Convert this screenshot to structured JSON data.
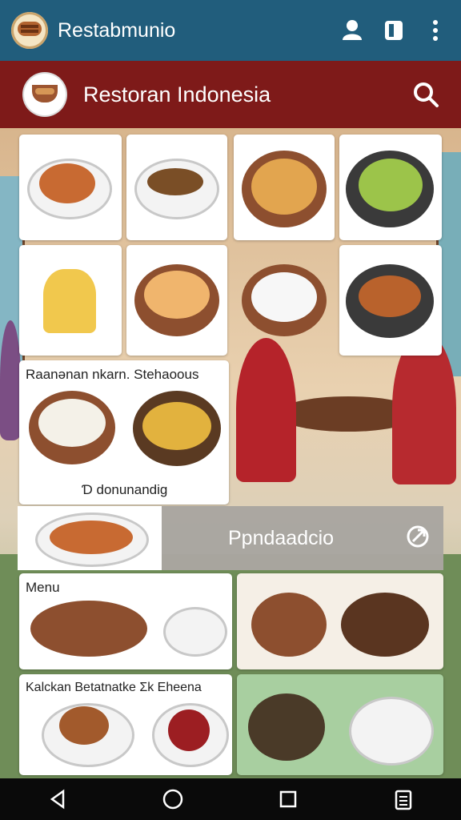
{
  "app": {
    "name": "Restabmunio"
  },
  "header": {
    "title": "Restoran Indonesia"
  },
  "labels": {
    "card1": "Raanənan nkarn. Stehaoous",
    "card1_sub": "Ɗ donunandig",
    "banner": "Ppndaadcio",
    "menu": "Menu",
    "card2": "Kalckan Betatnatke Ʃk Eheena"
  },
  "icons": {
    "profile": "person-icon",
    "book": "book-icon",
    "more": "more-vert-icon",
    "search": "search-icon",
    "share": "share-icon",
    "back": "back-icon",
    "home": "home-icon",
    "recent": "recent-apps-icon",
    "extra": "clipboard-icon"
  }
}
